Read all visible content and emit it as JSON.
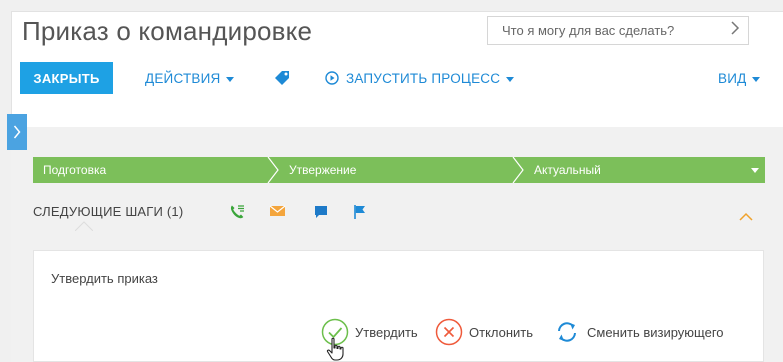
{
  "page": {
    "title": "Приказ о командировке"
  },
  "search": {
    "placeholder": "Что я могу для вас сделать?"
  },
  "toolbar": {
    "close_label": "ЗАКРЫТЬ",
    "actions_label": "ДЕЙСТВИЯ",
    "run_process_label": "ЗАПУСТИТЬ ПРОЦЕСС",
    "view_label": "ВИД"
  },
  "stages": [
    {
      "label": "Подготовка"
    },
    {
      "label": "Утвержение"
    },
    {
      "label": "Актуальный"
    }
  ],
  "next_steps": {
    "title": "СЛЕДУЮЩИЕ ШАГИ (1)",
    "icons": [
      "call-icon",
      "email-icon",
      "chat-icon",
      "flag-icon"
    ]
  },
  "task": {
    "title": "Утвердить приказ",
    "actions": [
      {
        "label": "Утвердить",
        "icon": "check-circle-icon",
        "color": "#6cbf4b"
      },
      {
        "label": "Отклонить",
        "icon": "cross-circle-icon",
        "color": "#ef5a3b"
      },
      {
        "label": "Сменить визирующего",
        "icon": "refresh-icon",
        "color": "#1e8ad6"
      }
    ]
  },
  "colors": {
    "accent": "#1ea1e4",
    "stage_bar": "#7cbf5a",
    "link": "#1e8ad6",
    "expand_caret": "#f0a22b"
  }
}
